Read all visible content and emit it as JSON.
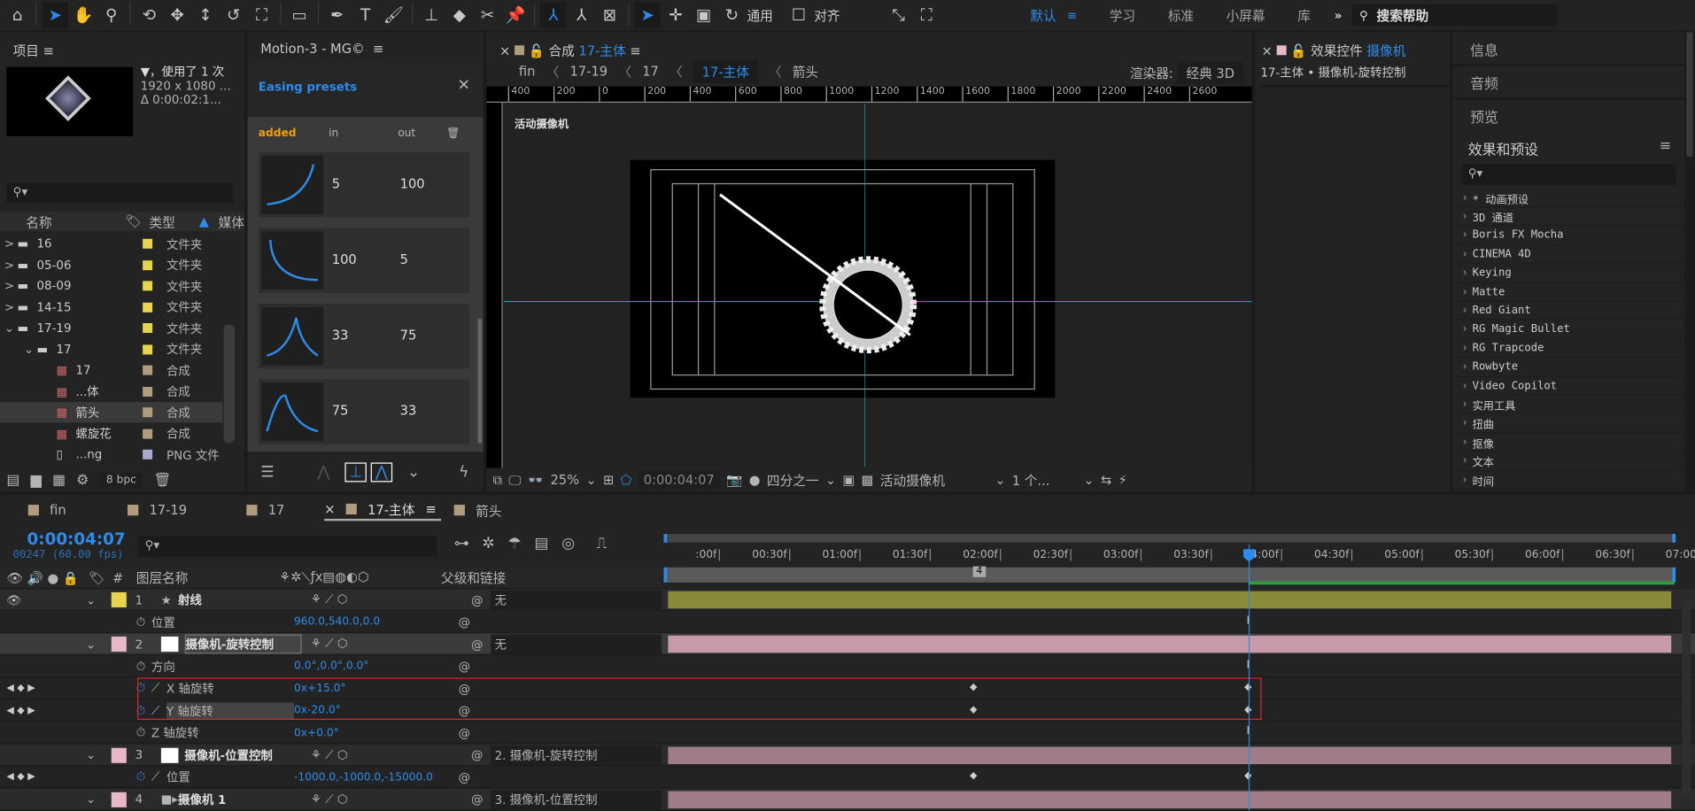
{
  "toolbar": {
    "workspace_label": "通用",
    "snap_label": "对齐",
    "workspaces": [
      "默认",
      "学习",
      "标准",
      "小屏幕",
      "库"
    ],
    "active_workspace": "默认",
    "search_help": "搜索帮助",
    "icons": [
      "home-icon",
      "selection-icon",
      "hand-icon",
      "zoom-icon",
      "orbit-icon",
      "pan-icon",
      "dolly-icon",
      "rotate-icon",
      "pan-behind-icon",
      "rectangle-icon",
      "pen-icon",
      "text-icon",
      "brush-icon",
      "clone-stamp-icon",
      "eraser-icon",
      "roto-brush-icon",
      "puppet-icon"
    ]
  },
  "project": {
    "title": "项目",
    "info_line1": "▼，使用了 1 次",
    "info_line2": "1920 x 1080 ...",
    "info_line3": "Δ 0:00:02:1...",
    "col_name": "名称",
    "col_type": "类型",
    "col_media": "媒体",
    "bpc": "8 bpc",
    "items": [
      {
        "indent": 0,
        "expand": ">",
        "icon": "folder",
        "name": "16",
        "color": "#e8d44d",
        "type": "文件夹"
      },
      {
        "indent": 0,
        "expand": ">",
        "icon": "folder",
        "name": "05-06",
        "color": "#e8d44d",
        "type": "文件夹"
      },
      {
        "indent": 0,
        "expand": ">",
        "icon": "folder",
        "name": "08-09",
        "color": "#e8d44d",
        "type": "文件夹"
      },
      {
        "indent": 0,
        "expand": ">",
        "icon": "folder",
        "name": "14-15",
        "color": "#e8d44d",
        "type": "文件夹"
      },
      {
        "indent": 0,
        "expand": "v",
        "icon": "folder",
        "name": "17-19",
        "color": "#e8d44d",
        "type": "文件夹"
      },
      {
        "indent": 1,
        "expand": "v",
        "icon": "folder",
        "name": "17",
        "color": "#e8d44d",
        "type": "文件夹"
      },
      {
        "indent": 2,
        "expand": "",
        "icon": "comp",
        "name": "17",
        "color": "#b19c7d",
        "type": "合成"
      },
      {
        "indent": 2,
        "expand": "",
        "icon": "comp",
        "name": "...体",
        "color": "#b19c7d",
        "type": "合成"
      },
      {
        "indent": 2,
        "expand": "",
        "icon": "comp",
        "name": "箭头",
        "color": "#b19c7d",
        "type": "合成",
        "selected": true
      },
      {
        "indent": 2,
        "expand": "",
        "icon": "comp",
        "name": "螺旋花",
        "color": "#b19c7d",
        "type": "合成"
      },
      {
        "indent": 2,
        "expand": "",
        "icon": "png",
        "name": "...ng",
        "color": "#a9a9d0",
        "type": "PNG 文件"
      }
    ]
  },
  "motion": {
    "title": "Motion-3 - MG©",
    "section": "Easing presets",
    "col_added": "added",
    "col_in": "in",
    "col_out": "out",
    "presets": [
      {
        "in": "5",
        "out": "100"
      },
      {
        "in": "100",
        "out": "5"
      },
      {
        "in": "33",
        "out": "75"
      },
      {
        "in": "75",
        "out": "33"
      }
    ]
  },
  "comp": {
    "title_prefix": "合成",
    "title_name": "17-主体",
    "breadcrumbs": [
      "fin",
      "17-19",
      "17",
      "17-主体",
      "箭头"
    ],
    "active_crumb": "17-主体",
    "renderer_label": "渲染器:",
    "renderer_value": "经典 3D",
    "active_camera_label": "活动摄像机",
    "ruler_labels": [
      "400",
      "200",
      "0",
      "200",
      "400",
      "600",
      "800",
      "1000",
      "1200",
      "1400",
      "1600",
      "1800",
      "2000",
      "2200",
      "2400",
      "2600"
    ],
    "footer": {
      "zoom": "25%",
      "timecode": "0:00:04:07",
      "resolution": "四分之一",
      "view": "活动摄像机",
      "views": "1 个..."
    }
  },
  "effects_controls": {
    "title_prefix": "效果控件",
    "title_layer": "摄像机",
    "breadcrumb": "17-主体 • 摄像机-旋转控制"
  },
  "right": {
    "panels": [
      "信息",
      "音频",
      "预览"
    ],
    "effects_title": "效果和预设",
    "effects": [
      "* 动画预设",
      "3D 通道",
      "Boris FX Mocha",
      "CINEMA 4D",
      "Keying",
      "Matte",
      "Red Giant",
      "RG Magic Bullet",
      "RG Trapcode",
      "Rowbyte",
      "Video Copilot",
      "实用工具",
      "扭曲",
      "抠像",
      "文本",
      "时间"
    ]
  },
  "timeline": {
    "tabs": [
      {
        "label": "fin",
        "active": false
      },
      {
        "label": "17-19",
        "active": false
      },
      {
        "label": "17",
        "active": false
      },
      {
        "label": "17-主体",
        "active": true
      },
      {
        "label": "箭头",
        "active": false
      }
    ],
    "timecode": "0:00:04:07",
    "frame_info": "00247 (60.00 fps)",
    "col_layer_name": "图层名称",
    "col_parent": "父级和链接",
    "ruler": [
      ":00f",
      "00:30f",
      "01:00f",
      "01:30f",
      "02:00f",
      "02:30f",
      "03:00f",
      "03:30f",
      "04:00f",
      "04:30f",
      "05:00f",
      "05:30f",
      "06:00f",
      "06:30f",
      "07:00f"
    ],
    "work_area_marker": "4",
    "rows": [
      {
        "kind": "layer",
        "num": "1",
        "name": "射线",
        "color": "#e8d44d",
        "icon": "star",
        "parent": "无",
        "bar": "#8a8a3a",
        "eye": true
      },
      {
        "kind": "prop",
        "name": "位置",
        "value": "960.0,540.0,0.0"
      },
      {
        "kind": "layer",
        "num": "2",
        "name": "摄像机-旋转控制",
        "color": "#e8b8c8",
        "icon": "solid",
        "parent": "无",
        "bar": "#c79aaa",
        "selected": true
      },
      {
        "kind": "prop",
        "name": "方向",
        "value": "0.0°,0.0°,0.0°"
      },
      {
        "kind": "prop",
        "name": "X 轴旋转",
        "value": "0x+15.0°",
        "keyed": true
      },
      {
        "kind": "prop",
        "name": "Y 轴旋转",
        "value": "0x-20.0°",
        "keyed": true,
        "highlight": true
      },
      {
        "kind": "prop",
        "name": "Z 轴旋转",
        "value": "0x+0.0°"
      },
      {
        "kind": "layer",
        "num": "3",
        "name": "摄像机-位置控制",
        "color": "#e8b8c8",
        "icon": "solid",
        "parent": "2. 摄像机-旋转控制",
        "bar": "#a07c88"
      },
      {
        "kind": "prop",
        "name": "位置",
        "value": "-1000.0,-1000.0,-15000.0",
        "keyed": true
      },
      {
        "kind": "layer",
        "num": "4",
        "name": "摄像机 1",
        "color": "#e8b8c8",
        "icon": "camera",
        "parent": "3. 摄像机-位置控制",
        "bar": "#a07c88"
      }
    ]
  },
  "colors": {
    "accent": "#2d8ceb",
    "playhead": "#2d8ceb",
    "highlight_box": "#e0242a"
  }
}
